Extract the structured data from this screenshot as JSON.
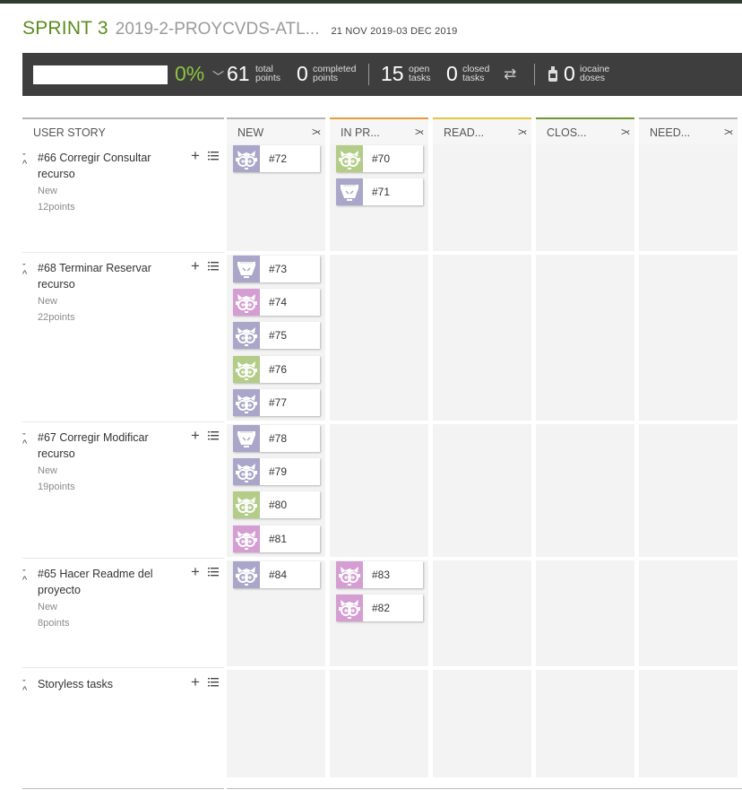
{
  "sprint": {
    "name": "SPRINT 3",
    "project": "2019-2-PROYCVDS-ATL...",
    "dates": "21 NOV 2019-03 DEC 2019"
  },
  "summary": {
    "progress_fraction": 0,
    "percent": "0%",
    "total_points": "61",
    "total_points_label": "total\npoints",
    "completed_points": "0",
    "completed_points_label": "completed\npoints",
    "open_tasks": "15",
    "open_tasks_label": "open\ntasks",
    "closed_tasks": "0",
    "closed_tasks_label": "closed\ntasks",
    "iocaine_doses": "0",
    "iocaine_doses_label": "iocaine\ndoses",
    "icons": [
      "chevron-down-icon",
      "swap-arrows-icon",
      "iocaine-bottle-icon"
    ]
  },
  "board": {
    "user_story_header": "USER STORY",
    "columns": [
      {
        "label": "NEW",
        "color": "#b5b5b5"
      },
      {
        "label": "IN PR...",
        "color": "#e99a3c"
      },
      {
        "label": "READ...",
        "color": "#e6c341"
      },
      {
        "label": "CLOS...",
        "color": "#6e9a2f"
      },
      {
        "label": "NEED...",
        "color": "#b5b5b5"
      }
    ],
    "fold_symbol": ">‹",
    "add_symbol": "+",
    "collapse_symbol": "ˇ^"
  },
  "stories": [
    {
      "title": "#66 Corregir Consultar recurso",
      "status": "New",
      "points": "12points"
    },
    {
      "title": "#68 Terminar Reservar recurso",
      "status": "New",
      "points": "22points"
    },
    {
      "title": "#67 Corregir Modificar recurso",
      "status": "New",
      "points": "19points"
    },
    {
      "title": "#65 Hacer Readme del proyecto",
      "status": "New",
      "points": "8points"
    },
    {
      "title": "Storyless tasks",
      "status": "",
      "points": ""
    }
  ],
  "tasks": [
    {
      "ref": "#72",
      "avatar": "owl",
      "color": "#a9a6c9"
    },
    {
      "ref": "#70",
      "avatar": "owl",
      "color": "#b3cc88"
    },
    {
      "ref": "#71",
      "avatar": "bowl",
      "color": "#a9a6c9"
    },
    {
      "ref": "#73",
      "avatar": "bowl",
      "color": "#a9a6c9"
    },
    {
      "ref": "#74",
      "avatar": "owl",
      "color": "#d59ed3"
    },
    {
      "ref": "#75",
      "avatar": "owl",
      "color": "#a9a6c9"
    },
    {
      "ref": "#76",
      "avatar": "owl",
      "color": "#b3cc88"
    },
    {
      "ref": "#77",
      "avatar": "owl",
      "color": "#a9a6c9"
    },
    {
      "ref": "#78",
      "avatar": "bowl",
      "color": "#a9a6c9"
    },
    {
      "ref": "#79",
      "avatar": "owl",
      "color": "#a9a6c9"
    },
    {
      "ref": "#80",
      "avatar": "owl",
      "color": "#b3cc88"
    },
    {
      "ref": "#81",
      "avatar": "owl",
      "color": "#d59ed3"
    },
    {
      "ref": "#84",
      "avatar": "owl",
      "color": "#a9a6c9"
    },
    {
      "ref": "#83",
      "avatar": "owl",
      "color": "#d59ed3"
    },
    {
      "ref": "#82",
      "avatar": "owl",
      "color": "#d59ed3"
    }
  ]
}
